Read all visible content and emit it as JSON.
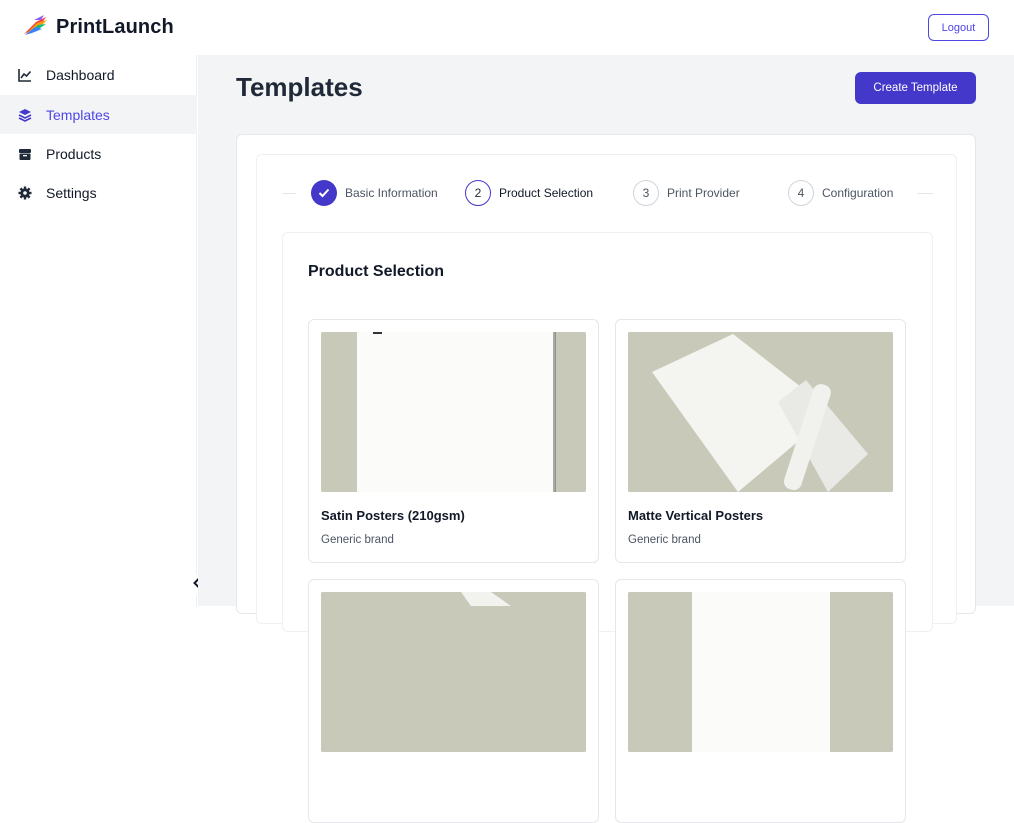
{
  "app": {
    "name": "PrintLaunch"
  },
  "header": {
    "logout_label": "Logout"
  },
  "sidebar": {
    "items": [
      {
        "label": "Dashboard",
        "icon": "chart-line-icon",
        "active": false
      },
      {
        "label": "Templates",
        "icon": "layers-icon",
        "active": true
      },
      {
        "label": "Products",
        "icon": "box-icon",
        "active": false
      },
      {
        "label": "Settings",
        "icon": "gear-icon",
        "active": false
      }
    ]
  },
  "page": {
    "title": "Templates",
    "create_label": "Create Template"
  },
  "stepper": {
    "steps": [
      {
        "number": "1",
        "label": "Basic Information",
        "state": "done"
      },
      {
        "number": "2",
        "label": "Product Selection",
        "state": "current"
      },
      {
        "number": "3",
        "label": "Print Provider",
        "state": "todo"
      },
      {
        "number": "4",
        "label": "Configuration",
        "state": "todo"
      }
    ]
  },
  "section": {
    "title": "Product Selection",
    "products": [
      {
        "name": "Satin Posters (210gsm)",
        "brand": "Generic brand"
      },
      {
        "name": "Matte Vertical Posters",
        "brand": "Generic brand"
      }
    ]
  },
  "colors": {
    "accent": "#4338ca",
    "image_background": "#c9c9b9"
  }
}
